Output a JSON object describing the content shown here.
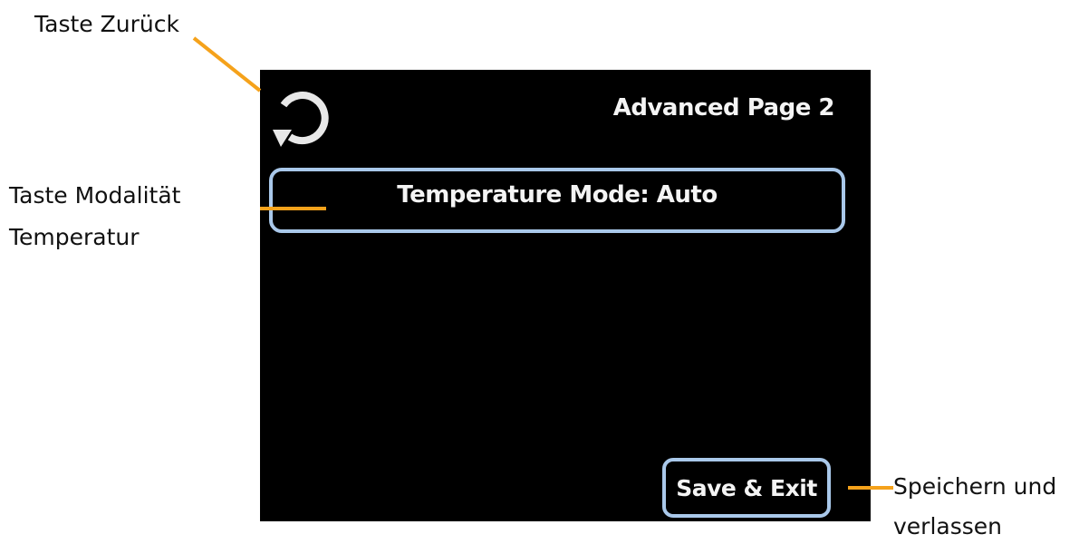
{
  "device_screen": {
    "title": "Advanced Page 2",
    "back_icon": "refresh-circular-arrow-icon",
    "temperature_mode_button": "Temperature Mode: Auto",
    "save_exit_button": "Save & Exit"
  },
  "callouts": {
    "back": "Taste Zurück",
    "mode_line1": "Taste Modalität",
    "mode_line2": "Temperatur",
    "save_line1": "Speichern und",
    "save_line2": "verlassen"
  },
  "colors": {
    "leader_line": "#f5a21b",
    "button_border": "#a9c8ea",
    "screen_background": "#000000",
    "text": "#f4f4f4"
  }
}
